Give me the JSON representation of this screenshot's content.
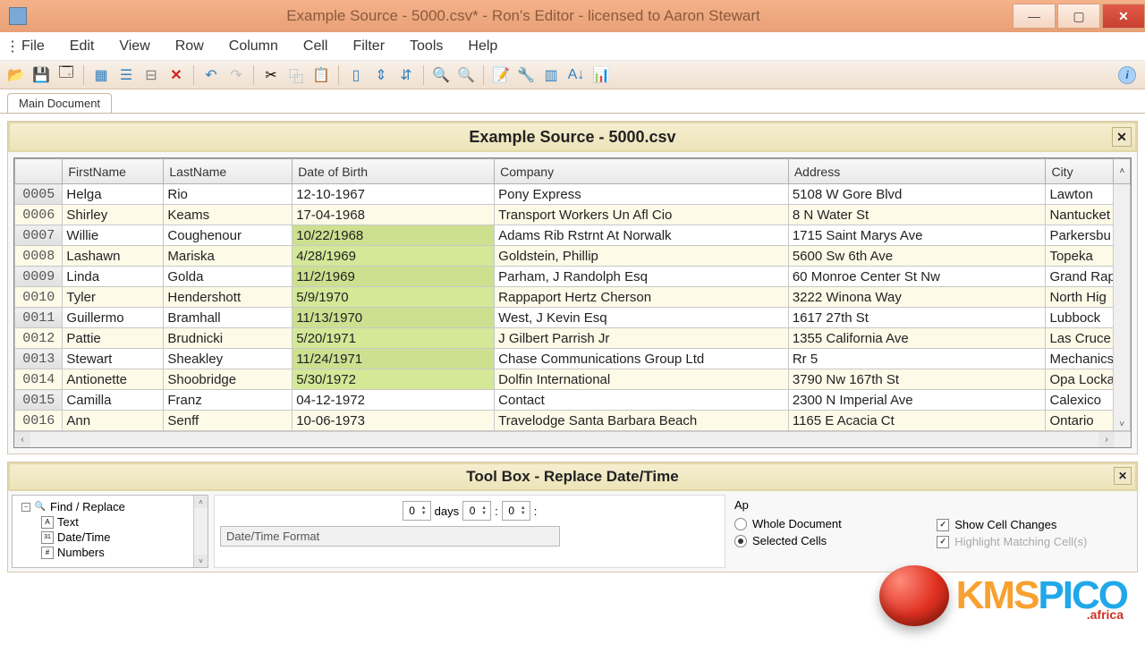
{
  "window": {
    "title": "Example Source - 5000.csv* - Ron's Editor - licensed to Aaron Stewart"
  },
  "menu": [
    "File",
    "Edit",
    "View",
    "Row",
    "Column",
    "Cell",
    "Filter",
    "Tools",
    "Help"
  ],
  "tab": "Main Document",
  "document": {
    "title": "Example Source - 5000.csv",
    "columns": [
      "FirstName",
      "LastName",
      "Date of Birth",
      "Company",
      "Address",
      "City"
    ],
    "rows": [
      {
        "n": "0005",
        "fn": "Helga",
        "ln": "Rio",
        "dob": "12-10-1967",
        "co": "Pony Express",
        "ad": "5108 W Gore Blvd",
        "ci": "Lawton",
        "hl": false
      },
      {
        "n": "0006",
        "fn": "Shirley",
        "ln": "Keams",
        "dob": "17-04-1968",
        "co": "Transport Workers Un Afl Cio",
        "ad": "8 N Water St",
        "ci": "Nantucket",
        "hl": false
      },
      {
        "n": "0007",
        "fn": "Willie",
        "ln": "Coughenour",
        "dob": "10/22/1968",
        "co": "Adams Rib Rstrnt At Norwalk",
        "ad": "1715 Saint Marys Ave",
        "ci": "Parkersbu",
        "hl": true
      },
      {
        "n": "0008",
        "fn": "Lashawn",
        "ln": "Mariska",
        "dob": "4/28/1969",
        "co": "Goldstein, Phillip",
        "ad": "5600 Sw 6th Ave",
        "ci": "Topeka",
        "hl": true
      },
      {
        "n": "0009",
        "fn": "Linda",
        "ln": "Golda",
        "dob": "11/2/1969",
        "co": "Parham, J Randolph Esq",
        "ad": "60 Monroe Center St Nw",
        "ci": "Grand Rap",
        "hl": true
      },
      {
        "n": "0010",
        "fn": "Tyler",
        "ln": "Hendershott",
        "dob": "5/9/1970",
        "co": "Rappaport Hertz Cherson",
        "ad": "3222 Winona Way",
        "ci": "North Hig",
        "hl": true
      },
      {
        "n": "0011",
        "fn": "Guillermo",
        "ln": "Bramhall",
        "dob": "11/13/1970",
        "co": "West, J Kevin Esq",
        "ad": "1617 27th St",
        "ci": "Lubbock",
        "hl": true
      },
      {
        "n": "0012",
        "fn": "Pattie",
        "ln": "Brudnicki",
        "dob": "5/20/1971",
        "co": "J Gilbert Parrish Jr",
        "ad": "1355 California Ave",
        "ci": "Las Cruce",
        "hl": true
      },
      {
        "n": "0013",
        "fn": "Stewart",
        "ln": "Sheakley",
        "dob": "11/24/1971",
        "co": "Chase Communications Group Ltd",
        "ad": "Rr 5",
        "ci": "Mechanics",
        "hl": true
      },
      {
        "n": "0014",
        "fn": "Antionette",
        "ln": "Shoobridge",
        "dob": "5/30/1972",
        "co": "Dolfin International",
        "ad": "3790 Nw 167th St",
        "ci": "Opa Locka",
        "hl": true
      },
      {
        "n": "0015",
        "fn": "Camilla",
        "ln": "Franz",
        "dob": "04-12-1972",
        "co": "Contact",
        "ad": "2300 N Imperial Ave",
        "ci": "Calexico",
        "hl": false
      },
      {
        "n": "0016",
        "fn": "Ann",
        "ln": "Senff",
        "dob": "10-06-1973",
        "co": "Travelodge Santa Barbara Beach",
        "ad": "1165 E Acacia Ct",
        "ci": "Ontario",
        "hl": false
      }
    ]
  },
  "toolbox": {
    "title": "Tool Box - Replace Date/Time",
    "nav_root": "Find / Replace",
    "nav_items": [
      "Text",
      "Date/Time",
      "Numbers"
    ],
    "days_label": "days",
    "spin_val": "0",
    "format_label": "Date/Time Format",
    "apply_label": "Ap",
    "radio_whole": "Whole Document",
    "radio_selected": "Selected Cells",
    "check_show": "Show Cell Changes",
    "check_highlight": "Highlight Matching Cell(s)"
  },
  "watermark": {
    "k": "KMS",
    "p": "PICO",
    "suffix": ".africa"
  }
}
